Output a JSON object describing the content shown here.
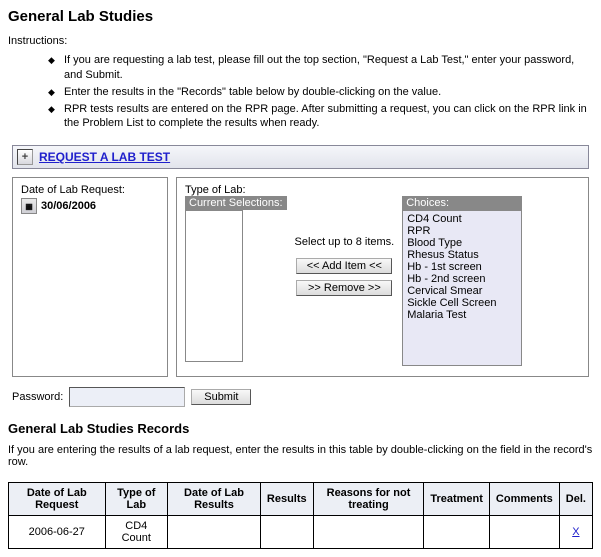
{
  "header": {
    "title": "General Lab Studies",
    "instructions_label": "Instructions:"
  },
  "instructions": [
    "If you are requesting a lab test, please fill out the top section, \"Request a Lab Test,\" enter your password, and Submit.",
    "Enter the results in the \"Records\" table below by double-clicking on the value.",
    "RPR tests results are entered on the RPR page. After submitting a request, you can click on the RPR link in the Problem List to complete the results when ready."
  ],
  "request_bar": {
    "label": "REQUEST A LAB TEST",
    "toggle_glyph": "+"
  },
  "date_panel": {
    "title": "Date of Lab Request:",
    "value": "30/06/2006"
  },
  "type_panel": {
    "title": "Type of Lab:",
    "current_label": "Current Selections:",
    "choices_label": "Choices:",
    "hint": "Select up to 8 items.",
    "add_btn": "<< Add Item <<",
    "remove_btn": ">> Remove >>",
    "choices": [
      "CD4 Count",
      "RPR",
      "Blood Type",
      "Rhesus Status",
      "Hb - 1st screen",
      "Hb - 2nd screen",
      "Cervical Smear",
      "Sickle Cell Screen",
      "Malaria Test"
    ]
  },
  "password": {
    "label": "Password:",
    "value": "",
    "submit": "Submit"
  },
  "records": {
    "title": "General Lab Studies Records",
    "desc": "If you are entering the results of a lab request, enter the results in this table by double-clicking on the field in the record's row.",
    "columns": [
      "Date of Lab Request",
      "Type of Lab",
      "Date of Lab Results",
      "Results",
      "Reasons for not treating",
      "Treatment",
      "Comments",
      "Del."
    ],
    "rows": [
      {
        "date_req": "2006-06-27",
        "type": "CD4 Count",
        "date_res": "",
        "results": "",
        "reasons": "",
        "treatment": "",
        "comments": "",
        "del": "X"
      }
    ]
  }
}
